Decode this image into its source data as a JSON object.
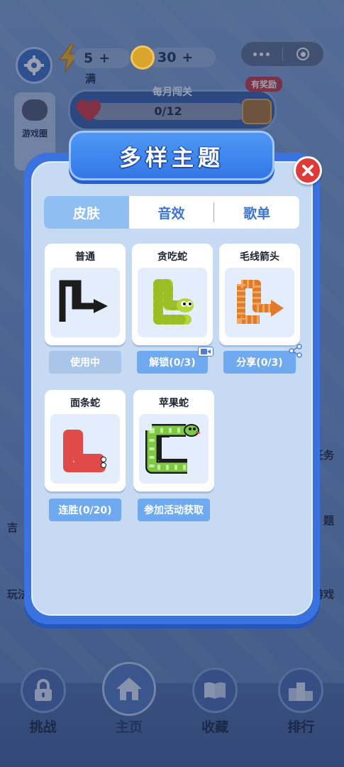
{
  "topbar": {
    "energy_value": "5",
    "energy_plus": "+",
    "energy_status": "满",
    "coin_value": "30",
    "coin_plus": "+"
  },
  "side_left": {
    "game_circle_label": "游戏圈",
    "partial_labels": [
      "吉",
      "玩法"
    ]
  },
  "side_right": {
    "partial_labels": [
      "任务",
      "题",
      "游戏"
    ]
  },
  "monthly": {
    "title": "每月闯关",
    "progress": "0/12",
    "progress_fraction": 0,
    "reward_tag": "有奖励"
  },
  "modal": {
    "title": "多样主题",
    "tabs": [
      {
        "label": "皮肤",
        "active": true
      },
      {
        "label": "音效",
        "active": false
      },
      {
        "label": "歌单",
        "active": false
      }
    ],
    "skins": [
      {
        "name": "普通",
        "button": "使用中",
        "icon": "arrow-icon"
      },
      {
        "name": "贪吃蛇",
        "button": "解锁(0/3)",
        "icon": "green-snake-icon",
        "badge": "video-icon"
      },
      {
        "name": "毛线箭头",
        "button": "分享(0/3)",
        "icon": "yarn-arrow-icon",
        "badge": "share-icon"
      },
      {
        "name": "面条蛇",
        "button": "连胜(0/20)",
        "icon": "noodle-snake-icon"
      },
      {
        "name": "苹果蛇",
        "button": "参加活动获取",
        "icon": "apple-snake-icon"
      }
    ]
  },
  "bottom_nav": [
    {
      "label": "挑战",
      "icon": "lock-icon"
    },
    {
      "label": "主页",
      "icon": "home-icon"
    },
    {
      "label": "收藏",
      "icon": "book-icon"
    },
    {
      "label": "排行",
      "icon": "podium-icon"
    }
  ],
  "colors": {
    "accent_blue": "#3a73df",
    "button_blue": "#6faaf0",
    "close_red": "#df3a3a"
  }
}
